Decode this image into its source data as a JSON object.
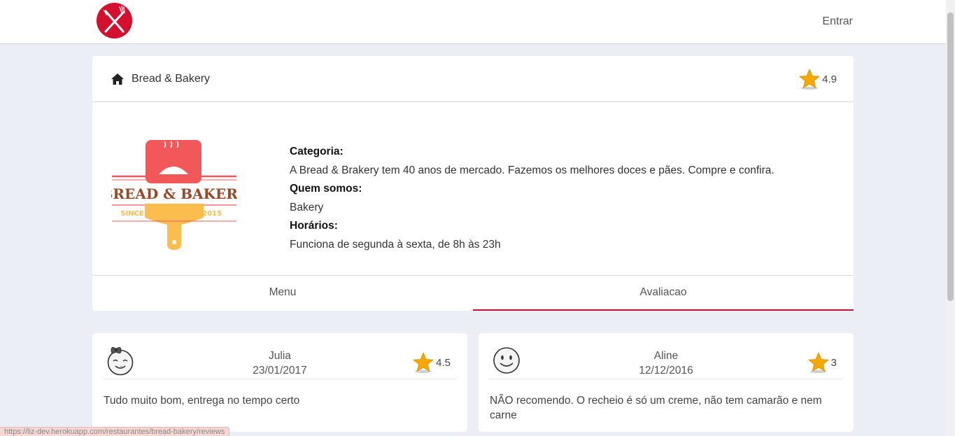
{
  "header": {
    "login_label": "Entrar"
  },
  "store": {
    "name": "Bread & Bakery",
    "rating": "4.9",
    "category_label": "Categoria:",
    "description": "A Bread & Brakery tem 40 anos de mercado. Fazemos os melhores doces e pães. Compre e confira.",
    "about_label": "Quem somos:",
    "about_value": "Bakery",
    "hours_label": "Horários:",
    "hours_value": "Funciona de segunda à sexta, de 8h às 23h",
    "logo_text": {
      "main": "BREAD & BAKERY",
      "since": "SINCE",
      "year": "2015"
    }
  },
  "tabs": [
    {
      "label": "Menu",
      "active": false
    },
    {
      "label": "Avaliacao",
      "active": true
    }
  ],
  "reviews": [
    {
      "name": "Julia",
      "date": "23/01/2017",
      "rating": "4.5",
      "text": "Tudo muito bom, entrega no tempo certo",
      "avatar_icon": "girl-face-icon"
    },
    {
      "name": "Aline",
      "date": "12/12/2016",
      "rating": "3",
      "text": "NÃO recomendo. O recheio é só um creme, não tem camarão e nem carne",
      "avatar_icon": "smiley-face-icon"
    }
  ],
  "status_bar": {
    "url": "https://liz-dev.herokuapp.com/restaurantes/bread-bakery/reviews"
  },
  "colors": {
    "accent": "#c8102e",
    "logo_red": "#d3102e",
    "star": "#f5a800",
    "background": "#ebeef5"
  }
}
